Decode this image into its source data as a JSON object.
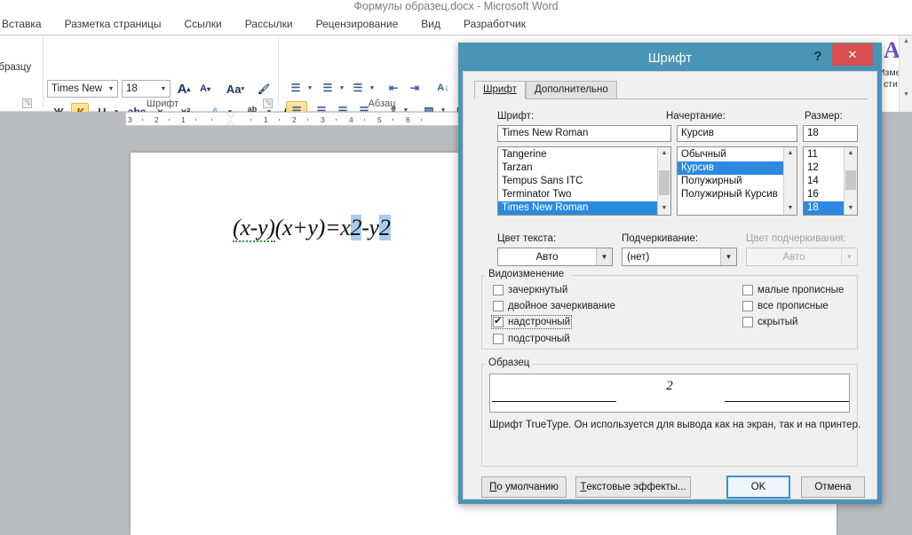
{
  "app": {
    "title": "Формулы образец.docx  -  Microsoft Word",
    "ribbon_tabs": [
      "Вставка",
      "Разметка страницы",
      "Ссылки",
      "Рассылки",
      "Рецензирование",
      "Вид",
      "Разработчик"
    ],
    "styles_group_partial_label": "образцу",
    "font_group": {
      "label": "Шрифт",
      "font_name": "Times New Rc",
      "font_size": "18",
      "grow_font_icon": "grow-font-icon",
      "shrink_font_icon": "shrink-font-icon",
      "change_case_icon": "Aa",
      "clear_formatting_icon": "clear-formatting-icon",
      "bold_label": "Ж",
      "italic_label": "К",
      "underline_label": "Ч",
      "strikethrough_label": "abc",
      "subscript_label": "x₂",
      "superscript_label": "x²",
      "text_effects_label": "A",
      "highlight_label": "ab",
      "font_color_label": "A"
    },
    "paragraph_group": {
      "label": "Абзац"
    },
    "styles_group_right": {
      "big_a": "A",
      "line1": "Изме",
      "line2": "сти"
    },
    "ruler": {
      "left_numbers": [
        "3",
        "2",
        "1"
      ],
      "right_numbers": [
        "1",
        "2",
        "3",
        "4",
        "5",
        "6"
      ]
    },
    "document": {
      "formula_prefix": "(x-y)",
      "formula_mid": "(x+y)=x",
      "sup1": "2",
      "formula_minus": "-y",
      "sup2": "2"
    }
  },
  "dialog": {
    "title": "Шрифт",
    "help_glyph": "?",
    "close_glyph": "✕",
    "close_color": "#d94f4f",
    "titlebar_color": "#4a94b5",
    "accent_selection": "#2a8ae0",
    "tabs": [
      {
        "label": "Шрифт",
        "active": true
      },
      {
        "label": "Дополнительно",
        "active": false
      }
    ],
    "font_label": "Шрифт:",
    "font_value": "Times New Roman",
    "font_list": [
      {
        "name": "Tangerine",
        "selected": false
      },
      {
        "name": "Tarzan",
        "selected": false
      },
      {
        "name": "Tempus Sans ITC",
        "selected": false
      },
      {
        "name": "Terminator Two",
        "selected": false
      },
      {
        "name": "Times New Roman",
        "selected": true
      }
    ],
    "style_label": "Начертание:",
    "style_value": "Курсив",
    "style_list": [
      {
        "name": "Обычный",
        "selected": false
      },
      {
        "name": "Курсив",
        "selected": true
      },
      {
        "name": "Полужирный",
        "selected": false
      },
      {
        "name": "Полужирный Курсив",
        "selected": false
      }
    ],
    "size_label": "Размер:",
    "size_value": "18",
    "size_list": [
      {
        "name": "11",
        "selected": false
      },
      {
        "name": "12",
        "selected": false
      },
      {
        "name": "14",
        "selected": false
      },
      {
        "name": "16",
        "selected": false
      },
      {
        "name": "18",
        "selected": true
      }
    ],
    "text_color_label": "Цвет текста:",
    "text_color_value": "Авто",
    "underline_label": "Подчеркивание:",
    "underline_value": "(нет)",
    "underline_color_label": "Цвет подчеркивания:",
    "underline_color_value": "Авто",
    "underline_color_disabled": true,
    "effects_group_label": "Видоизменение",
    "effects_left": [
      {
        "label": "зачеркнутый",
        "checked": false,
        "focused": false
      },
      {
        "label": "двойное зачеркивание",
        "checked": false,
        "focused": false
      },
      {
        "label": "надстрочный",
        "checked": true,
        "focused": true
      },
      {
        "label": "подстрочный",
        "checked": false,
        "focused": false
      }
    ],
    "effects_right": [
      {
        "label": "малые прописные",
        "checked": false,
        "focused": false
      },
      {
        "label": "все прописные",
        "checked": false,
        "focused": false
      },
      {
        "label": "скрытый",
        "checked": false,
        "focused": false
      }
    ],
    "sample_group_label": "Образец",
    "sample_text": "2",
    "sample_note": "Шрифт TrueType. Он используется для вывода как на экран, так и на принтер.",
    "buttons": {
      "default": "По умолчанию",
      "text_effects": "Текстовые эффекты...",
      "ok": "OK",
      "cancel": "Отмена"
    }
  }
}
